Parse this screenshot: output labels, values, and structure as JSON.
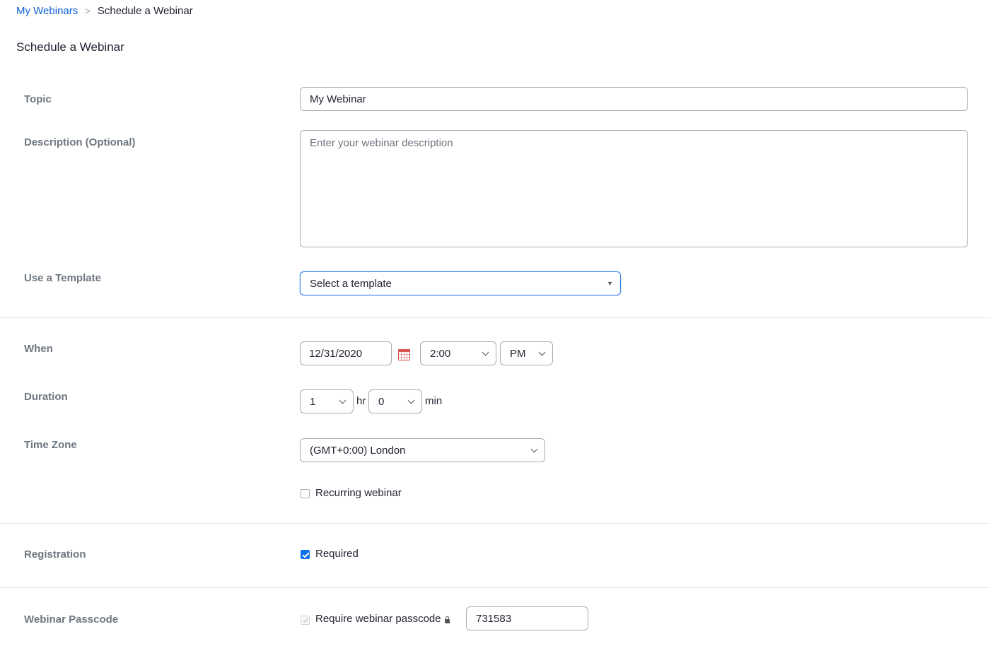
{
  "breadcrumb": {
    "parent": "My Webinars",
    "separator": ">",
    "current": "Schedule a Webinar"
  },
  "page_title": "Schedule a Webinar",
  "topic": {
    "label": "Topic",
    "value": "My Webinar"
  },
  "description": {
    "label": "Description (Optional)",
    "placeholder": "Enter your webinar description"
  },
  "template": {
    "label": "Use a Template",
    "selected": "Select a template"
  },
  "when": {
    "label": "When",
    "date": "12/31/2020",
    "time": "2:00",
    "ampm": "PM"
  },
  "duration": {
    "label": "Duration",
    "hours": "1",
    "hours_unit": "hr",
    "minutes": "0",
    "minutes_unit": "min"
  },
  "timezone": {
    "label": "Time Zone",
    "selected": "(GMT+0:00) London"
  },
  "recurring": {
    "label": "Recurring webinar",
    "checked": false
  },
  "registration": {
    "label": "Registration",
    "option": "Required",
    "checked": true
  },
  "passcode": {
    "label": "Webinar Passcode",
    "option": "Require webinar passcode",
    "checked": true,
    "value": "731583"
  },
  "colors": {
    "link": "#0e62d6",
    "accent": "#0e72ed",
    "label": "#6e7680",
    "border": "#a9abb3"
  }
}
